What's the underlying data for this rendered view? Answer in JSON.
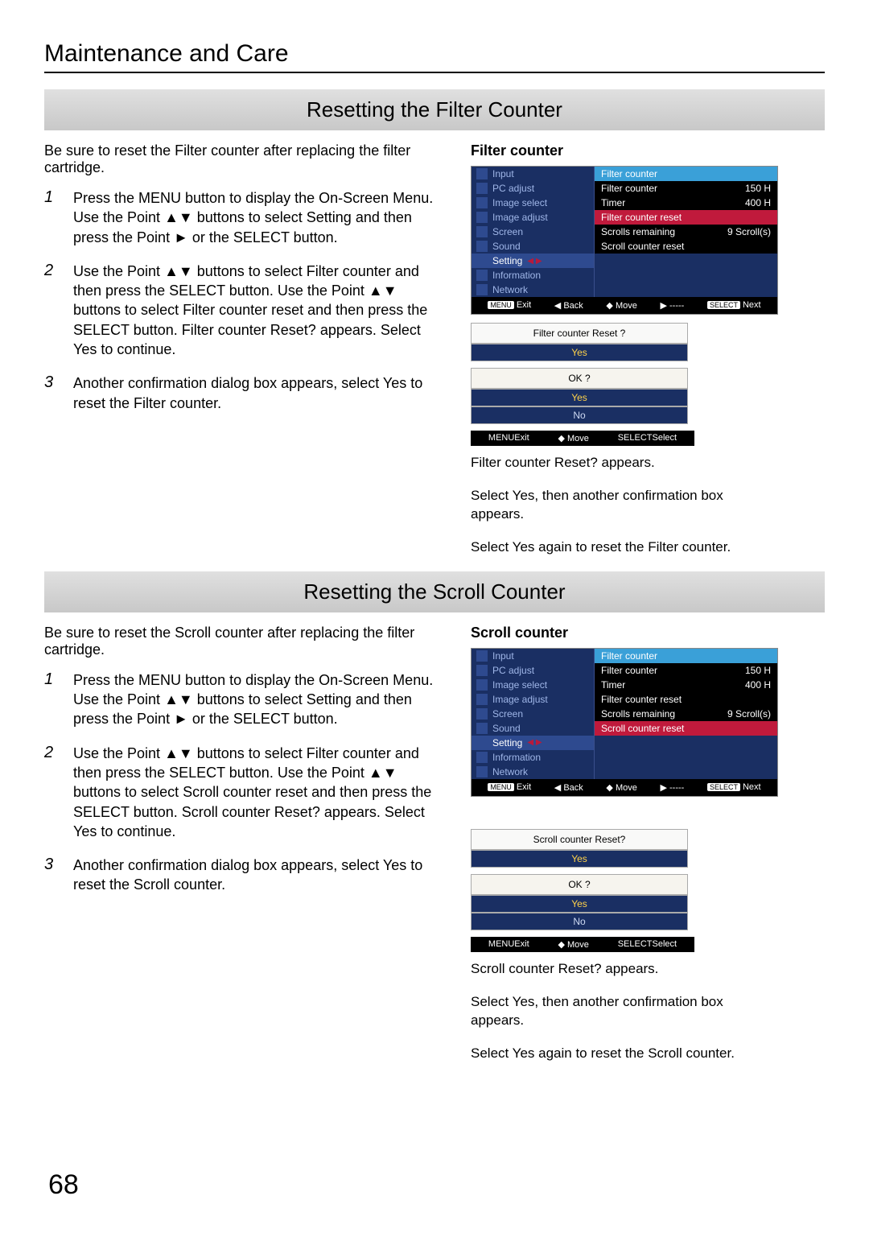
{
  "chapter": "Maintenance and Care",
  "pageNumber": "68",
  "sectionA": {
    "title": "Resetting the Filter Counter",
    "intro": "Be sure to reset the Filter counter after replacing the filter cartridge.",
    "steps": [
      {
        "n": "1",
        "t": "Press the MENU button to display the On-Screen Menu. Use the Point ▲▼ buttons to select Setting and then press the Point ► or the SELECT button."
      },
      {
        "n": "2",
        "t": "Use the Point ▲▼ buttons to select Filter counter and then press the SELECT button. Use the Point ▲▼ buttons to select Filter counter reset and then press the SELECT button. Filter counter Reset? appears. Select Yes to continue."
      },
      {
        "n": "3",
        "t": "Another confirmation dialog box appears, select Yes to reset the Filter counter."
      }
    ],
    "panelLabel": "Filter counter",
    "menu": {
      "header": "Filter counter",
      "left": [
        "Input",
        "PC adjust",
        "Image select",
        "Image adjust",
        "Screen",
        "Sound",
        "Setting",
        "Information",
        "Network"
      ],
      "right": [
        {
          "l": "Filter counter",
          "v": "150 H"
        },
        {
          "l": "Timer",
          "v": "400 H"
        },
        {
          "l": "Filter counter reset",
          "v": "",
          "hl": true
        },
        {
          "l": "Scrolls remaining",
          "v": "9 Scroll(s)"
        },
        {
          "l": "Scroll counter reset",
          "v": ""
        }
      ],
      "footer": {
        "exit": "Exit",
        "back": "Back",
        "move": "Move",
        "dash": "-----",
        "next": "Next"
      }
    },
    "dialog1": {
      "q": "Filter counter Reset ?",
      "yes": "Yes"
    },
    "dialog2": {
      "q": "OK ?",
      "yes": "Yes",
      "no": "No"
    },
    "dfooter": {
      "exit": "Exit",
      "move": "Move",
      "select": "Select"
    },
    "captions": [
      "Filter counter Reset? appears.",
      "Select Yes, then another confirmation box appears.",
      "Select Yes again to reset the Filter counter."
    ]
  },
  "sectionB": {
    "title": "Resetting the Scroll Counter",
    "intro": "Be sure to reset the Scroll counter after replacing the filter cartridge.",
    "steps": [
      {
        "n": "1",
        "t": "Press the MENU button to display the On-Screen Menu. Use the Point ▲▼ buttons to select Setting and then press the Point ► or the SELECT button."
      },
      {
        "n": "2",
        "t": "Use the Point ▲▼ buttons to select Filter counter and then press the SELECT button. Use the Point ▲▼ buttons to select Scroll counter reset and then press the SELECT button. Scroll counter Reset? appears. Select Yes to continue."
      },
      {
        "n": "3",
        "t": "Another confirmation dialog box appears, select Yes to reset the Scroll counter."
      }
    ],
    "panelLabel": "Scroll counter",
    "menu": {
      "header": "Filter counter",
      "left": [
        "Input",
        "PC adjust",
        "Image select",
        "Image adjust",
        "Screen",
        "Sound",
        "Setting",
        "Information",
        "Network"
      ],
      "right": [
        {
          "l": "Filter counter",
          "v": "150 H"
        },
        {
          "l": "Timer",
          "v": "400 H"
        },
        {
          "l": "Filter counter reset",
          "v": ""
        },
        {
          "l": "Scrolls remaining",
          "v": "9 Scroll(s)"
        },
        {
          "l": "Scroll counter reset",
          "v": "",
          "hl": true
        }
      ],
      "footer": {
        "exit": "Exit",
        "back": "Back",
        "move": "Move",
        "dash": "-----",
        "next": "Next"
      }
    },
    "dialog1": {
      "q": "Scroll counter Reset?",
      "yes": "Yes"
    },
    "dialog2": {
      "q": "OK ?",
      "yes": "Yes",
      "no": "No"
    },
    "dfooter": {
      "exit": "Exit",
      "move": "Move",
      "select": "Select"
    },
    "captions": [
      "Scroll counter Reset? appears.",
      "Select Yes, then another confirmation box appears.",
      "Select Yes again to reset the Scroll counter."
    ]
  }
}
